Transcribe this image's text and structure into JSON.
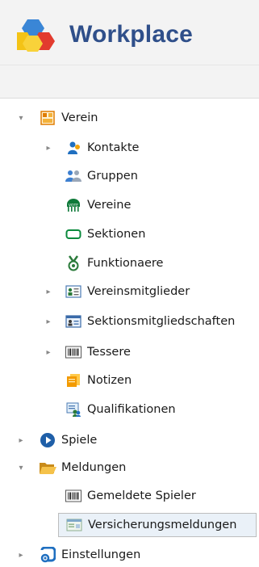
{
  "app": {
    "title": "Workplace"
  },
  "tree": [
    {
      "key": "verein",
      "label": "Verein",
      "level": 0,
      "toggle": "expanded",
      "icon": "verein-icon"
    },
    {
      "key": "kontakte",
      "label": "Kontakte",
      "level": 1,
      "toggle": "collapsed",
      "icon": "contacts-icon"
    },
    {
      "key": "gruppen",
      "label": "Gruppen",
      "level": 1,
      "toggle": "none",
      "icon": "group-icon"
    },
    {
      "key": "vereine",
      "label": "Vereine",
      "level": 1,
      "toggle": "none",
      "icon": "vote-icon"
    },
    {
      "key": "sektionen",
      "label": "Sektionen",
      "level": 1,
      "toggle": "none",
      "icon": "tag-icon"
    },
    {
      "key": "funktionaere",
      "label": "Funktionaere",
      "level": 1,
      "toggle": "none",
      "icon": "medal-icon"
    },
    {
      "key": "vereinsmitglieder",
      "label": "Vereinsmitglieder",
      "level": 1,
      "toggle": "collapsed",
      "icon": "member-card-icon"
    },
    {
      "key": "sektionsmitgliedschaften",
      "label": "Sektionsmitgliedschaften",
      "level": 1,
      "toggle": "collapsed",
      "icon": "membership-card-icon"
    },
    {
      "key": "tessere",
      "label": "Tessere",
      "level": 1,
      "toggle": "collapsed",
      "icon": "barcode-icon"
    },
    {
      "key": "notizen",
      "label": "Notizen",
      "level": 1,
      "toggle": "none",
      "icon": "notes-icon"
    },
    {
      "key": "qualifikationen",
      "label": "Qualifikationen",
      "level": 1,
      "toggle": "none",
      "icon": "qualification-icon"
    },
    {
      "key": "spiele",
      "label": "Spiele",
      "level": 0,
      "toggle": "collapsed",
      "icon": "play-icon"
    },
    {
      "key": "meldungen",
      "label": "Meldungen",
      "level": 0,
      "toggle": "expanded",
      "icon": "folder-open-icon"
    },
    {
      "key": "gemeldete-spieler",
      "label": "Gemeldete Spieler",
      "level": 1,
      "toggle": "none",
      "icon": "barcode-icon"
    },
    {
      "key": "versicherungsmeldungen",
      "label": "Versicherungsmeldungen",
      "level": 1,
      "toggle": "none",
      "icon": "insurance-card-icon",
      "selected": true
    },
    {
      "key": "einstellungen",
      "label": "Einstellungen",
      "level": 0,
      "toggle": "collapsed",
      "icon": "settings-icon"
    }
  ]
}
